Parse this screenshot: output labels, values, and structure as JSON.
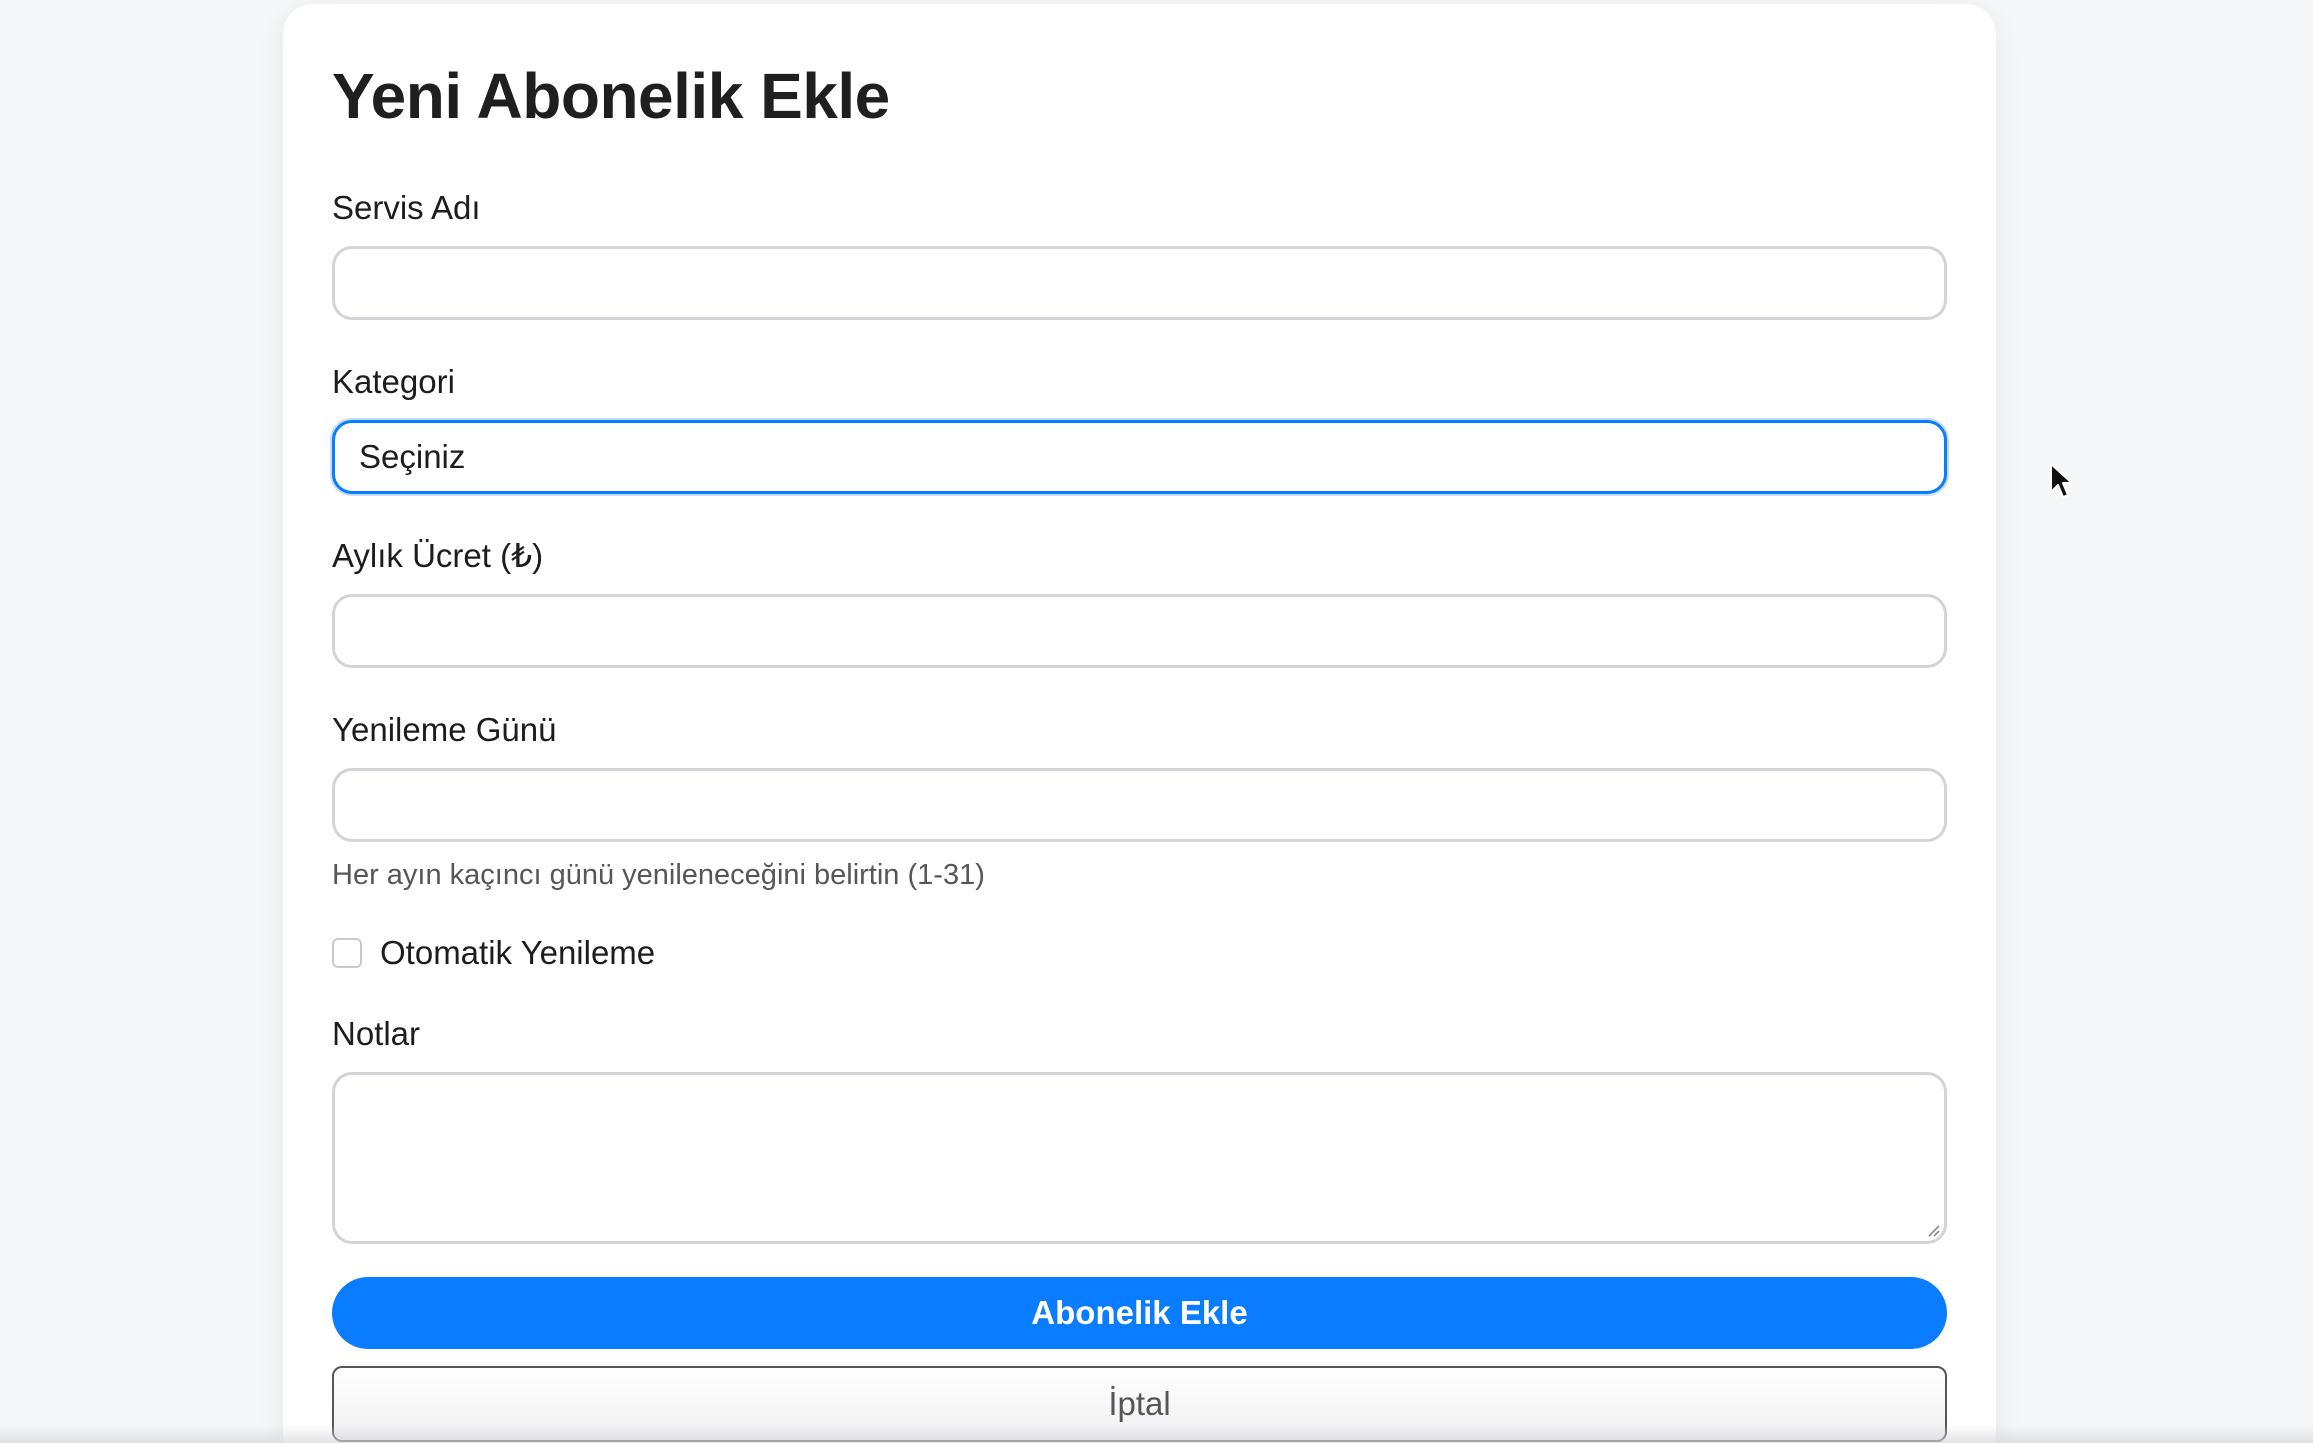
{
  "form": {
    "title": "Yeni Abonelik Ekle",
    "service_name": {
      "label": "Servis Adı",
      "value": ""
    },
    "category": {
      "label": "Kategori",
      "selected": "Seçiniz"
    },
    "monthly_fee": {
      "label": "Aylık Ücret (₺)",
      "value": ""
    },
    "renewal_day": {
      "label": "Yenileme Günü",
      "value": "",
      "hint": "Her ayın kaçıncı günü yenileneceğini belirtin (1-31)"
    },
    "auto_renew": {
      "label": "Otomatik Yenileme",
      "checked": false
    },
    "notes": {
      "label": "Notlar",
      "value": ""
    },
    "submit_label": "Abonelik Ekle",
    "cancel_label": "İptal"
  },
  "colors": {
    "accent": "#0a7cff",
    "background": "#f6f7f9",
    "card": "#ffffff",
    "input_border": "#d4d4d8"
  },
  "icons": {
    "cursor": "mouse-pointer-icon",
    "resize": "resize-handle-icon"
  }
}
